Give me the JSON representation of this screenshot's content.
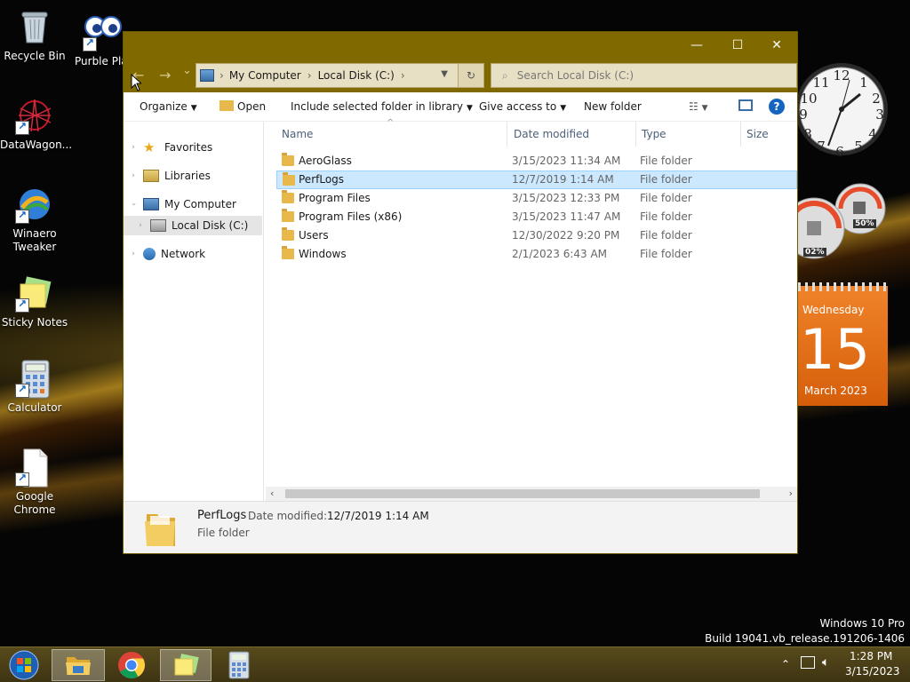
{
  "desktop": {
    "icons": [
      {
        "label": "Recycle Bin"
      },
      {
        "label": "Purble Pla"
      },
      {
        "label": "DataWagon..."
      },
      {
        "label": "Winaero Tweaker"
      },
      {
        "label": "Sticky Notes"
      },
      {
        "label": "Calculator"
      },
      {
        "label": "Google Chrome"
      }
    ],
    "watermark": {
      "line1": "Windows 10 Pro",
      "line2": "Build 19041.vb_release.191206-1406"
    }
  },
  "window": {
    "controls": {
      "minimize": "—",
      "maximize": "☐",
      "close": "✕"
    },
    "nav": {
      "back": "←",
      "forward": "→",
      "recent": "⌄"
    },
    "address": {
      "segments": [
        "My Computer",
        "Local Disk (C:)"
      ],
      "sep": "›"
    },
    "refresh": "↻",
    "search": {
      "placeholder": "Search Local Disk (C:)"
    },
    "commands": {
      "organize": "Organize",
      "open": "Open",
      "include": "Include selected folder in library",
      "share": "Give access to",
      "new_folder": "New folder"
    },
    "help": "?",
    "navpane": {
      "favorites": "Favorites",
      "libraries": "Libraries",
      "my_computer": "My Computer",
      "local_disk": "Local Disk (C:)",
      "network": "Network"
    },
    "columns": {
      "name": "Name",
      "date": "Date modified",
      "type": "Type",
      "size": "Size"
    },
    "files": [
      {
        "name": "AeroGlass",
        "date": "3/15/2023 11:34 AM",
        "type": "File folder"
      },
      {
        "name": "PerfLogs",
        "date": "12/7/2019 1:14 AM",
        "type": "File folder"
      },
      {
        "name": "Program Files",
        "date": "3/15/2023 12:33 PM",
        "type": "File folder"
      },
      {
        "name": "Program Files (x86)",
        "date": "3/15/2023 11:47 AM",
        "type": "File folder"
      },
      {
        "name": "Users",
        "date": "12/30/2022 9:20 PM",
        "type": "File folder"
      },
      {
        "name": "Windows",
        "date": "2/1/2023 6:43 AM",
        "type": "File folder"
      }
    ],
    "details": {
      "name": "PerfLogs",
      "date_label": "Date modified:",
      "date_value": "12/7/2019 1:14 AM",
      "type": "File folder"
    }
  },
  "gadgets": {
    "meter_cpu": "02%",
    "meter_mem": "50%",
    "calendar": {
      "weekday": "Wednesday",
      "day": "15",
      "month": "March 2023"
    }
  },
  "taskbar": {
    "time": "1:28 PM",
    "date": "3/15/2023",
    "tray_caret": "⌃"
  },
  "colors": {
    "title_bar": "#806a00",
    "selection": "#cce8ff",
    "calendar": "#e8701a"
  }
}
